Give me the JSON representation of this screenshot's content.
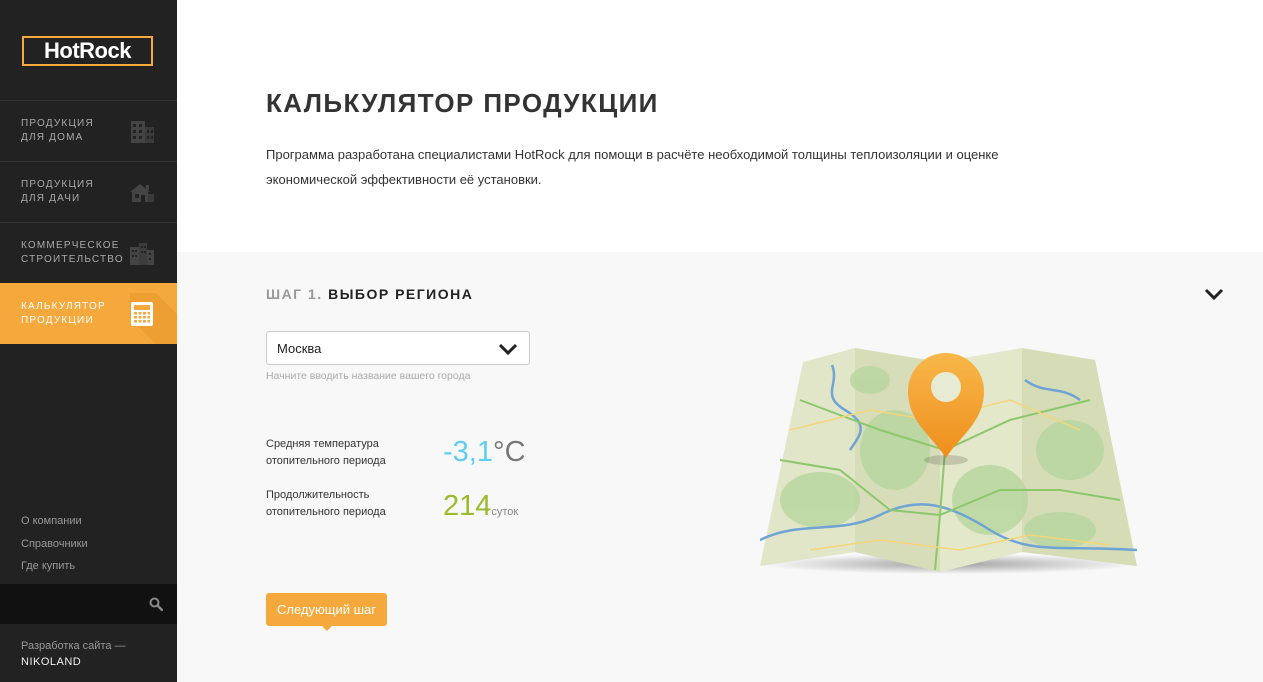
{
  "sidebar": {
    "logo": "HotRock",
    "nav": [
      {
        "label": "ПРОДУКЦИЯ\nДЛЯ ДОМА",
        "icon": "building-icon"
      },
      {
        "label": "ПРОДУКЦИЯ\nДЛЯ ДАЧИ",
        "icon": "house-icon"
      },
      {
        "label": "КОММЕРЧЕСКОЕ\nСТРОИТЕЛЬСТВО",
        "icon": "commercial-buildings-icon"
      },
      {
        "label": "КАЛЬКУЛЯТОР\nПРОДУКЦИИ",
        "icon": "calculator-icon",
        "active": true
      }
    ],
    "links": [
      "О компании",
      "Справочники",
      "Где купить"
    ],
    "search": {
      "placeholder": "",
      "icon": "search-icon"
    },
    "credit": {
      "text": "Разработка сайта —",
      "brand": "NIKOLAND"
    }
  },
  "page": {
    "title": "КАЛЬКУЛЯТОР ПРОДУКЦИИ",
    "intro": "Программа разработана специалистами HotRock для помощи в расчёте необходимой толщины теплоизоляции и оценке экономической эффективности её установки."
  },
  "step": {
    "number": "ШАГ 1.",
    "title": "ВЫБОР РЕГИОНА",
    "region_select": {
      "value": "Москва",
      "hint": "Начните вводить название вашего города"
    },
    "temperature": {
      "label": "Средняя температура\nотопительного периода",
      "value": "-3,1",
      "unit": "°C"
    },
    "duration": {
      "label": "Продолжительность\nотопительного периода",
      "value": "214",
      "unit": "суток"
    },
    "next_button": "Следующий шаг",
    "map_icon": "map-pin-icon"
  },
  "colors": {
    "accent": "#f5a93c",
    "sidebar_bg": "#222222",
    "temp_value": "#5ccff0",
    "duration_value": "#9bbb2d"
  }
}
